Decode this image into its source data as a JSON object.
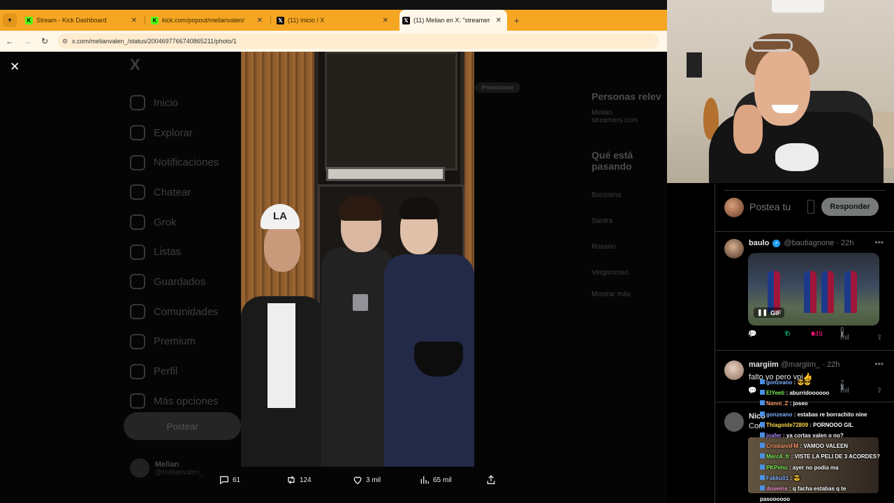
{
  "browser": {
    "tabs": [
      {
        "label": "Stream - Kick Dashboard",
        "favicon": "kick-icon",
        "active": false
      },
      {
        "label": "kick.com/popout/melianvalen/",
        "favicon": "kick-icon",
        "active": false
      },
      {
        "label": "(11) Inicio / X",
        "favicon": "x-icon",
        "active": false
      },
      {
        "label": "(11) Melian en X: \"streamers de",
        "favicon": "x-icon",
        "active": true
      }
    ],
    "new_tab": "+",
    "url": "x.com/melianvalen_/status/2004697766740865211/photo/1",
    "accent_color": "#f5a623"
  },
  "x_sidebar": {
    "logo": "X",
    "items": [
      "Inicio",
      "Explorar",
      "Notificaciones",
      "Chatear",
      "Grok",
      "Listas",
      "Guardados",
      "Comunidades",
      "Premium",
      "Perfil",
      "Más opciones"
    ],
    "post_button": "Postear",
    "user_name": "Melian",
    "user_handle": "@melianvalen_"
  },
  "x_right": {
    "search_chip": "Promocionar",
    "relevant_heading": "Personas relev",
    "relevant_user": "Melian",
    "relevant_bio": "streamers com",
    "trending_heading": "Qué está pasando",
    "trends": [
      "Bonzoma",
      "Sardra",
      "Rosario",
      "Vergonzoso"
    ],
    "show_more": "Mostrar más"
  },
  "photo": {
    "cap_logo": "LA"
  },
  "photo_actions": {
    "replies": "61",
    "reposts": "124",
    "likes": "3 mil",
    "views": "65 mil"
  },
  "reply_panel": {
    "placeholder": "Postea tu",
    "reply_button": "Responder",
    "tweets": [
      {
        "name": "baulo",
        "handle": "@bautiagnone",
        "time": "22h",
        "gif_label": "GIF",
        "replies": "4",
        "reposts": "7",
        "likes": "449",
        "views": "6 mil",
        "like_color": "#f91880"
      },
      {
        "name": "margiim",
        "handle": "@margiim_",
        "time": "22h",
        "text": "falto yo pero vpi👍",
        "views": "2 mil"
      },
      {
        "name": "Nico",
        "text": "Com"
      }
    ]
  },
  "chat": [
    {
      "user": "gonzeano",
      "color": "#7fb3ff",
      "text": "😎😎"
    },
    {
      "user": "ElYeeti",
      "color": "#7cf05a",
      "text": "aburridoooooo"
    },
    {
      "user": "Nanni_Z",
      "color": "#ff9a6b",
      "text": "joseo"
    },
    {
      "user": "gonzeano",
      "color": "#7fb3ff",
      "text": "estabas re borrachito nine"
    },
    {
      "user": "Thiagoide72809",
      "color": "#ffd84a",
      "text": "PORNOOO GIL"
    },
    {
      "user": "joafer",
      "color": "#b48cff",
      "text": "ya cortas valen o no?"
    },
    {
      "user": "CristiannFM",
      "color": "#ff9a6b",
      "text": "VAMOO VALEEN"
    },
    {
      "user": "Merc4_fr",
      "color": "#7cf05a",
      "text": "VISTE LA PELI DE 3 ACORDES?"
    },
    {
      "user": "PKPehu",
      "color": "#7cf05a",
      "text": "ayer no podia ma"
    },
    {
      "user": "Fakku01",
      "color": "#7fb3ff",
      "text": "😎"
    },
    {
      "user": "doseiris",
      "color": "#ff9ad5",
      "text": "q facha estabas q te"
    },
    {
      "user": "",
      "color": "#ffffff",
      "text": "pasoooooo"
    }
  ]
}
